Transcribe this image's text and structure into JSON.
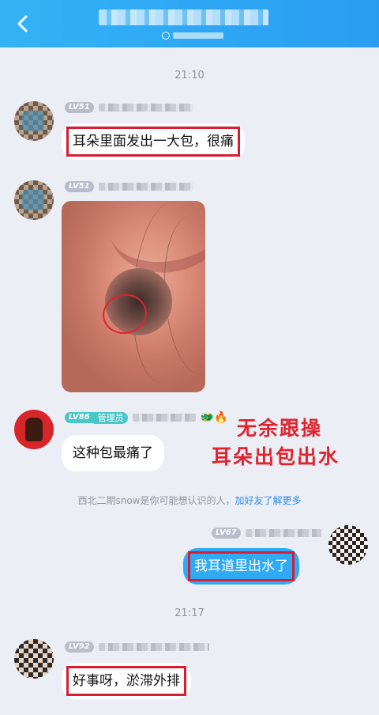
{
  "header": {
    "back_icon": "chevron-left-icon"
  },
  "timestamps": [
    "21:10",
    "21:17"
  ],
  "messages": [
    {
      "level": "LV51",
      "text": "耳朵里面发出一大包，很痛"
    },
    {
      "level": "LV51",
      "image": "ear-photo"
    },
    {
      "level": "LV86",
      "role": "管理员",
      "text": "这种包最痛了"
    },
    {
      "level": "LV67",
      "text": "我耳道里出水了"
    },
    {
      "level": "LV92",
      "text": "好事呀，淤滞外排"
    }
  ],
  "overlay_text": {
    "line1": "无余跟操",
    "line2": "耳朵出包出水"
  },
  "system_notice": {
    "text": "西北二期snow是你可能想认识的人，",
    "link": "加好友了解更多"
  },
  "colors": {
    "header": "#2aa6f4",
    "highlight": "#d81c34",
    "own_bubble": "#30aaf4"
  }
}
